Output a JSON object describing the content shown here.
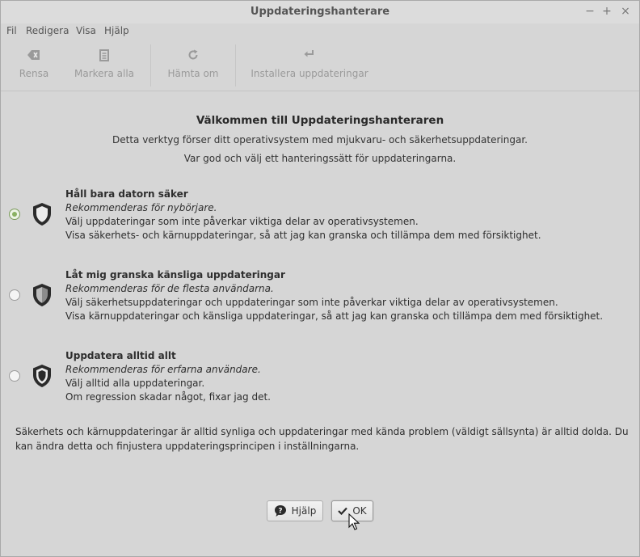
{
  "window": {
    "title": "Uppdateringshanterare",
    "controls": {
      "minimize": "−",
      "maximize": "+",
      "close": "×"
    }
  },
  "menubar": {
    "items": [
      "Fil",
      "Redigera",
      "Visa",
      "Hjälp"
    ]
  },
  "toolbar": {
    "clear": {
      "label": "Rensa",
      "icon": "backspace-icon"
    },
    "select_all": {
      "label": "Markera alla",
      "icon": "document-icon"
    },
    "refresh": {
      "label": "Hämta om",
      "icon": "refresh-icon"
    },
    "install": {
      "label": "Installera uppdateringar",
      "icon": "enter-icon"
    }
  },
  "main": {
    "heading": "Välkommen till Uppdateringshanteraren",
    "intro1": "Detta verktyg förser ditt operativsystem med mjukvaru- och säkerhetsuppdateringar.",
    "intro2": "Var god och välj ett hanteringssätt för uppdateringarna.",
    "options": [
      {
        "title": "Håll bara datorn säker",
        "recommend": "Rekommenderas för nybörjare.",
        "line1": "Välj uppdateringar som inte påverkar viktiga delar av operativsystemen.",
        "line2": "Visa säkerhets- och kärnuppdateringar, så att jag kan granska och tillämpa dem med försiktighet.",
        "selected": true,
        "icon": "shield-empty-icon"
      },
      {
        "title": "Låt mig granska känsliga uppdateringar",
        "recommend": "Rekommenderas för de flesta användarna.",
        "line1": "Välj säkerhetsuppdateringar och uppdateringar som inte påverkar viktiga delar av operativsystemen.",
        "line2": "Visa kärnuppdateringar och känsliga uppdateringar, så att jag kan granska och tillämpa dem med försiktighet.",
        "selected": false,
        "icon": "shield-half-icon"
      },
      {
        "title": "Uppdatera alltid allt",
        "recommend": "Rekommenderas för erfarna användare.",
        "line1": "Välj alltid alla uppdateringar.",
        "line2": "Om regression skadar något, fixar jag det.",
        "selected": false,
        "icon": "shield-full-icon"
      }
    ],
    "note": "Säkerhets och kärnuppdateringar är alltid synliga och uppdateringar med kända problem (väldigt sällsynta) är alltid dolda. Du kan ändra detta och finjustera uppdateringsprincipen i inställningarna."
  },
  "buttons": {
    "help": "Hjälp",
    "ok": "OK"
  },
  "colors": {
    "accent": "#8ab162",
    "shield": "#2b2b2b"
  }
}
